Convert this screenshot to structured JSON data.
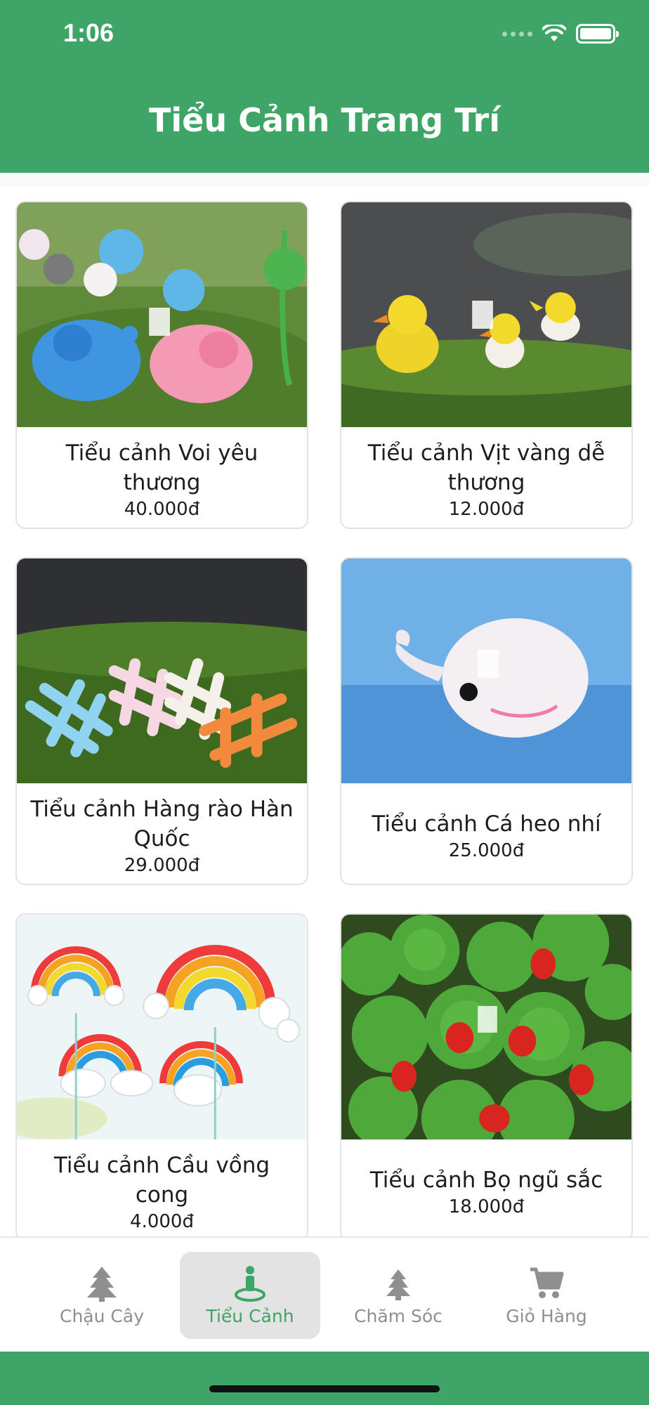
{
  "status_bar": {
    "time": "1:06"
  },
  "header": {
    "title": "Tiểu Cảnh Trang Trí"
  },
  "products": [
    {
      "name": "Tiểu cảnh Voi yêu thương",
      "price": "40.000đ",
      "image": "elephants-figurines"
    },
    {
      "name": "Tiểu cảnh Vịt vàng dễ thương",
      "price": "12.000đ",
      "image": "yellow-ducks-figurines"
    },
    {
      "name": "Tiểu cảnh Hàng rào Hàn Quốc",
      "price": "29.000đ",
      "image": "fence-figurines"
    },
    {
      "name": "Tiểu cảnh Cá heo nhí",
      "price": "25.000đ",
      "image": "whale-figurine"
    },
    {
      "name": "Tiểu cảnh Cầu vồng cong",
      "price": "4.000đ",
      "image": "rainbow-figurines"
    },
    {
      "name": "Tiểu cảnh Bọ ngũ sắc",
      "price": "18.000đ",
      "image": "ladybug-figurines"
    }
  ],
  "tabs": [
    {
      "label": "Chậu Cây",
      "icon": "tree-icon",
      "active": false
    },
    {
      "label": "Tiểu Cảnh",
      "icon": "person-pin-icon",
      "active": true
    },
    {
      "label": "Chăm Sóc",
      "icon": "tree-icon",
      "active": false
    },
    {
      "label": "Giỏ Hàng",
      "icon": "cart-icon",
      "active": false
    }
  ],
  "colors": {
    "primary": "#3ea566",
    "tab_inactive": "#8f8f8f",
    "tab_active_bg": "#e3e3e3"
  }
}
